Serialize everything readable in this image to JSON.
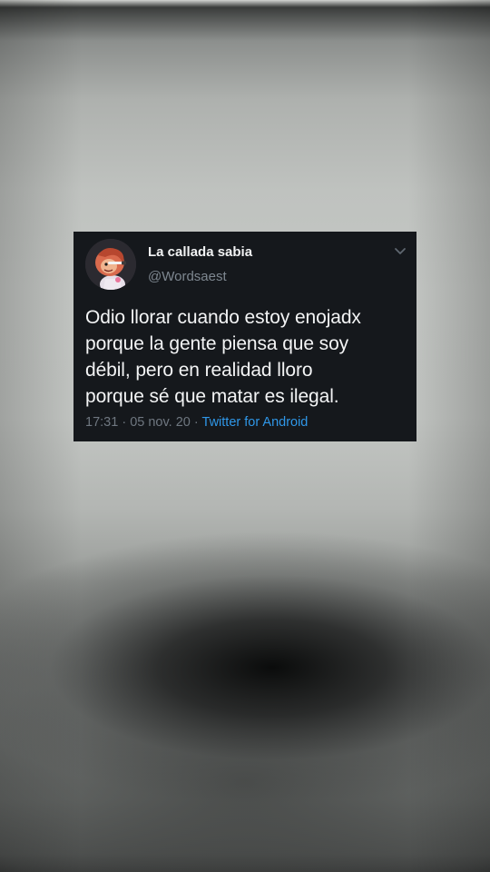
{
  "tweet": {
    "display_name": "La callada sabia",
    "handle": "@Wordsaest",
    "text_lines": [
      "Odio llorar cuando estoy enojadx",
      "porque la gente piensa que soy",
      "débil, pero en realidad lloro",
      "porque sé que matar es ilegal."
    ],
    "time": "17:31",
    "separator1": "·",
    "date": "05 nov. 20",
    "separator2": "·",
    "source": "Twitter for Android",
    "avatar_icon": "cartoon-character-avatar",
    "menu_icon": "chevron-down-icon"
  },
  "colors": {
    "card_background": "#15181c",
    "text_primary": "#f3f4f5",
    "text_secondary": "#7e8790",
    "link_blue": "#2f97e8"
  }
}
